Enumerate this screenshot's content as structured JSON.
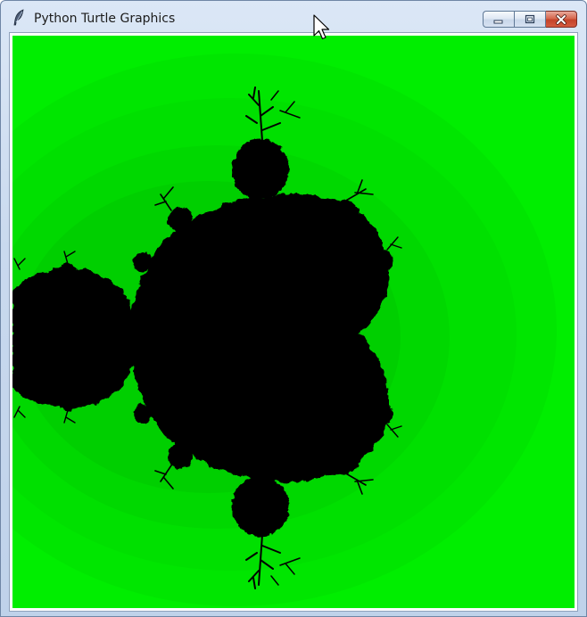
{
  "window": {
    "title": "Python Turtle Graphics",
    "title_icon": "feather-icon"
  },
  "controls": {
    "minimize_icon": "minimize-icon",
    "maximize_icon": "maximize-icon",
    "close_icon": "close-icon"
  },
  "canvas": {
    "content": "mandelbrot-fractal",
    "colors": {
      "background": "#00ee00",
      "band_dark": "#00d800",
      "set": "#000000"
    }
  },
  "colors": {
    "titlebar": "#c9d9ee",
    "close_button": "#c5432a"
  }
}
